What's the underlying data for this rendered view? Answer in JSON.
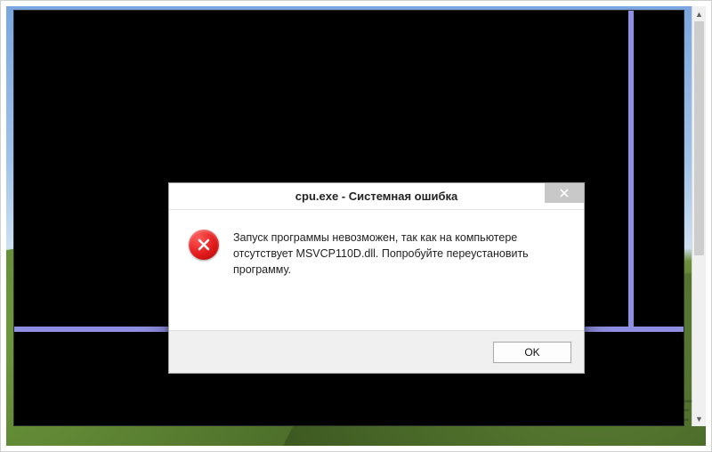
{
  "dialog": {
    "title": "cpu.exe - Системная ошибка",
    "message": "Запуск программы невозможен, так как на компьютере отсутствует MSVCP110D.dll. Попробуйте переустановить программу.",
    "ok_label": "OK"
  },
  "watermark": {
    "line1": "ALL-",
    "line2": "FREE"
  }
}
